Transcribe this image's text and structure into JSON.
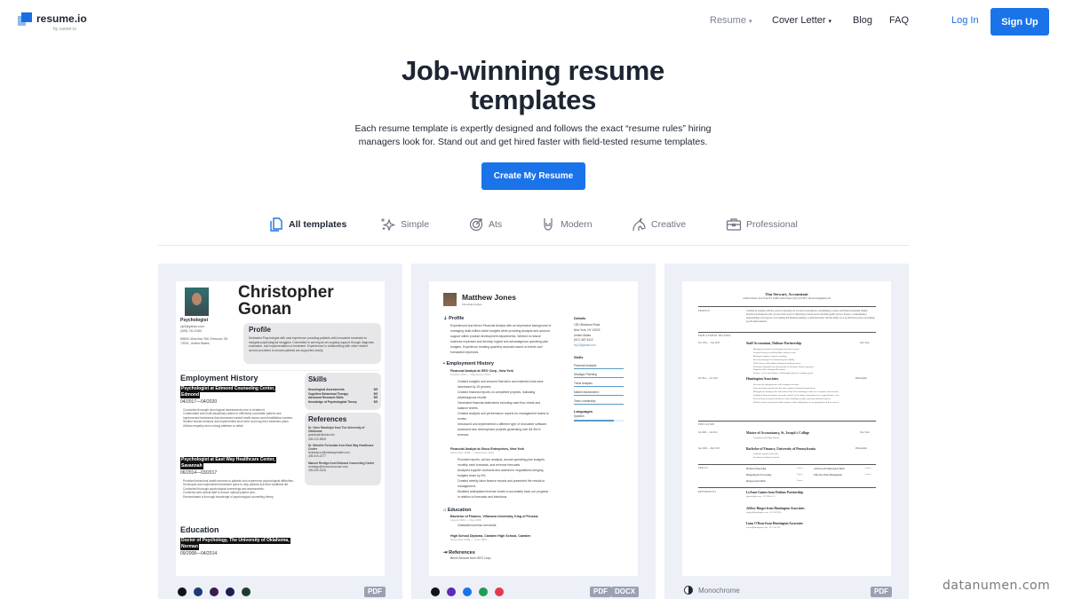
{
  "header": {
    "logo": {
      "name": "resume.io",
      "sub": "by career.io"
    },
    "nav": [
      {
        "label": "Resume",
        "has_dropdown": true,
        "muted": true
      },
      {
        "label": "Cover Letter",
        "has_dropdown": true
      },
      {
        "label": "Blog"
      },
      {
        "label": "FAQ"
      }
    ],
    "login": "Log In",
    "signup": "Sign Up",
    "chevron": "⌄"
  },
  "hero": {
    "title_line1": "Job-winning resume",
    "title_line2": "templates",
    "subtitle_line1": "Each resume template is expertly designed and follows the exact “resume rules” hiring",
    "subtitle_line2": "managers look for. Stand out and get hired faster with field-tested resume templates.",
    "cta": "Create My Resume"
  },
  "filters": [
    {
      "label": "All templates",
      "icon": "documents-icon",
      "active": true
    },
    {
      "label": "Simple",
      "icon": "sparkles-icon"
    },
    {
      "label": "Ats",
      "icon": "target-icon"
    },
    {
      "label": "Modern",
      "icon": "rock-hand-icon"
    },
    {
      "label": "Creative",
      "icon": "unicorn-icon"
    },
    {
      "label": "Professional",
      "icon": "briefcase-icon"
    }
  ],
  "colors": {
    "brand": "#1a73e8",
    "card_bg": "#eef0f8",
    "badge": "#9aa1b3"
  },
  "templates": [
    {
      "name_line1": "Christopher",
      "name_line2": "Gonan",
      "job_title": "Psychologist",
      "contact": [
        "cjc3@yahoo.com",
        "(405) 741-9183"
      ],
      "address": [
        "55600 42nd Ave SW, Edmond, OK",
        "73001, United States"
      ],
      "profile_heading": "Profile",
      "profile_text": "Dedicated Psychologist with vast experience providing patients with innovative treatment to navigate psychological struggles. Committed to serving as an ongoing support through diagnosis evaluation, and implementation of treatment. Experienced in collaborating with other related service providers to ensure patients are supported wholly.",
      "employment_heading": "Employment History",
      "jobs": [
        {
          "title_line1": "Psychologist at Edmond Counseling Center,",
          "title_line2": "Edmond",
          "dates": "04/2017—04/2020",
          "bullets": [
            "Conducted thorough neurological assessments prior to treatment.",
            "Collaborated with multi-disciplinary teams to effectively coordinate patient care.",
            "Implemented treatments that decreased mental health issues and rehabilitation barriers.",
            "Studied human behavior and implemented short-term and long-term treatment plans.",
            "Utilized empathy and a strong attention to detail."
          ]
        },
        {
          "title_line1": "Psychologist at East Way Healthcare Center,",
          "title_line2": "Savannah",
          "dates": "06/2014—03/2017",
          "bullets": [
            "Provided behavioral health services to patients who experience psychological difficulties.",
            "Developed and implemented treatment plans to help patients live their healthiest life.",
            "Conducted thorough psychological screenings and assessments.",
            "Conferred with clinical staff to ensure optimal patient care.",
            "Demonstrated a thorough knowledge of psychological counseling theory."
          ]
        }
      ],
      "education_heading": "Education",
      "education": {
        "line1": "Doctor of Psychology, The University of Oklahoma,",
        "line2": "Norman",
        "dates": "09/2008—04/2014"
      },
      "skills_heading": "Skills",
      "skills": [
        {
          "name": "Neurological Assessments",
          "level": "5/5"
        },
        {
          "name": "Cognitive Behavioral Therapy",
          "level": "5/5"
        },
        {
          "name": "Advanced Research Skills",
          "level": "5/5"
        },
        {
          "name": "Knowledge of Psychological Theory",
          "level": "5/5"
        }
      ],
      "references_heading": "References",
      "references": [
        {
          "name": "Dr. Gene Randolph from The University of Oklahoma",
          "email": "grandolph@okla.edu",
          "phone": "405-212-9808"
        },
        {
          "name": "Dr. Michelle Fortunato from East Way Healthcare Center",
          "email": "fortunato.m@eastwayhealth.com",
          "phone": "405-519-2277"
        },
        {
          "name": "Manuel Restigo from Edmond Counseling Center",
          "email": "mrestigo@edmondcounsel.com",
          "phone": "405-549-3108"
        }
      ],
      "swatches": [
        "#111418",
        "#1f3a6e",
        "#3b1e4f",
        "#1b1f55",
        "#1f3b2c"
      ],
      "formats": [
        "PDF"
      ]
    },
    {
      "name": "Matthew Jones",
      "job_title": "Financial Analyst",
      "profile_heading": "Profile",
      "profile_text": "Experienced and driven Financial Analyst with an impressive background of managing multi-million dollar budgets while providing analysis and account support within product development departments. Worked to reduce business expenses and develop logical and advantageous operating plan budgets. Experience creating quarterly accruals based on trends and forecasted expenses.",
      "employment_heading": "Employment History",
      "jobs": [
        {
          "title": "Financial Analyst at GEO Corp., New York",
          "dates": "October 2012 — September 2022",
          "bullets": [
            "Created budgets and ensured that labor and material costs were decreased by 15 percent.",
            "Created financial reports on completed projects, indicating advantageous results.",
            "Generated financial statements including cash flow charts and balance sheets.",
            "Created analysis and performance reports for management teams to review.",
            "Introduced and implemented a different type of innovative software.",
            "Assessed new development projects generating over $4.3M in revenue."
          ]
        },
        {
          "title": "Financial Analyst at Sisco Enterprises, New York",
          "dates": "September 2008 — September 2012",
          "bullets": [
            "Provided reports, ad-hoc analysis, annual operating plan budgets, monthly cash forecasts, and revenue forecasts.",
            "Analyzed supplier contracts and advised in negotiations bringing budgets down by 6%.",
            "Created weekly labor finance reports and presented the results to management.",
            "Modeled anticipated revenue charts to accurately track our progress in relation to forecasts and intentions."
          ]
        }
      ],
      "education_heading": "Education",
      "education": [
        {
          "title": "Bachelor of Finance, Villanova University, King of Prussia",
          "dates": "August 2004 — May 2008",
          "bullets": [
            "Graduated summa cum laude."
          ]
        },
        {
          "title": "High School Diploma, Camden High School, Camden",
          "dates": "September 2000 — June 2004"
        }
      ],
      "references_heading": "References",
      "references": [
        "Bevin Strozza from GEO Corp."
      ],
      "details_heading": "Details",
      "details": [
        "135 Oklahoma Road",
        "New York, NY 10029",
        "United States",
        "(917) 487 5412",
        "mj12@gmail.com"
      ],
      "skills_heading": "Skills",
      "skills": [
        "Financial Analysis",
        "Strategic Planning",
        "Trend Analysis",
        "Market Assessment",
        "Team Leadership"
      ],
      "languages_heading": "Languages",
      "languages": [
        {
          "name": "Spanish",
          "level": 0.8
        }
      ],
      "swatches": [
        "#111418",
        "#5b2bb5",
        "#1a73e8",
        "#1f9d55",
        "#e03b4a"
      ],
      "formats": [
        "PDF",
        "DOCX"
      ]
    },
    {
      "name": "Tim Stewart, Accountant",
      "contact": "4 Oxford Street, New York, NY 11486, United States, (917) 476 3675, tim.stewart@gmail.com",
      "sections": {
        "profile": "PROFILE",
        "employment": "EMPLOYMENT HISTORY",
        "education": "EDUCATION",
        "skills": "SKILLS",
        "references": "REFERENCES"
      },
      "profile_text": "Certified Accountant with five years of experience in account reconciliations, streamlining accounts, and financial planning. Highly motivated professional with a proven track record of delivering accurate reports and high quality service. Possess a comprehensive understanding of all aspects of accounting and financial planning. A dedicated leader with the ability to be an effective resource in assisting growth improvements.",
      "jobs": [
        {
          "dates": "Nov 2021 — Sep 2024",
          "title": "Staff Accountant, Dulione Partnership",
          "location": "New York",
          "bullets": [
            "Managed accounts by analyzing costs and revenues.",
            "Prepared binary record bloodline analysis work.",
            "Managed complete expense reporting.",
            "Develop strategies for minimizing tax liability.",
            "Work closely with auditors during all audit processes.",
            "Performed financial risk assessments for all future business projects.",
            "Organized files and payrolls reports.",
            "Prepare, review and balance credit budget plans for company goals."
          ]
        },
        {
          "dates": "Jul 2014 — Oct 2021",
          "title": "Huntington Associates",
          "location": "Philadelphia",
          "bullets": [
            "Oversaw the management of all company accounts.",
            "Processed staff payroll and other task reports of financial transactions.",
            "Managed accounting teams and ensured that all accounting records were complete and accurate.",
            "Explained financial matters to people outside of the finance department in a comprehensive way.",
            "Reviewed professional and discreet when handling sensitive personal financial matters.",
            "Worked closely and assisted staff members while adding them to the preparation of their careers."
          ]
        }
      ],
      "education": [
        {
          "dates": "Jul 2008 — Jul 2012",
          "title": "Master of Accountancy, St. Joseph's College",
          "location": "New York",
          "bullets": [
            "Graduated with High Honors."
          ]
        },
        {
          "dates": "Sep 2006 — May 2013",
          "title": "Bachelor of Finance, University of Pennsylvania",
          "location": "Philadelphia",
          "bullets": [
            "Graduate summa cum laude.",
            "President of Student Council."
          ]
        }
      ],
      "skills": [
        {
          "name": "Financial Reporting",
          "level": "Expert"
        },
        {
          "name": "Advanced Technological Skills",
          "level": "Expert"
        },
        {
          "name": "Budgeting & Forecasting",
          "level": "Expert"
        },
        {
          "name": "Effective Time Management",
          "level": "Expert"
        },
        {
          "name": "Interpersonal Skills",
          "level": "Expert"
        }
      ],
      "references": [
        {
          "name": "LeAnne Gaines from Dulione Partnership",
          "contact": "lgaines@dp.com · 557 988 4 3 2"
        },
        {
          "name": "Jeffrey Ringer from Huntington Associates",
          "contact": "jringer@huntington.com · 47 556 9920"
        },
        {
          "name": "Liam O'Rear from Huntington Associates",
          "contact": "lorear@huntington.com · 915 254 747"
        }
      ],
      "color_mode": "Monochrome",
      "formats": [
        "PDF"
      ]
    }
  ],
  "watermark": "datanumen.com"
}
